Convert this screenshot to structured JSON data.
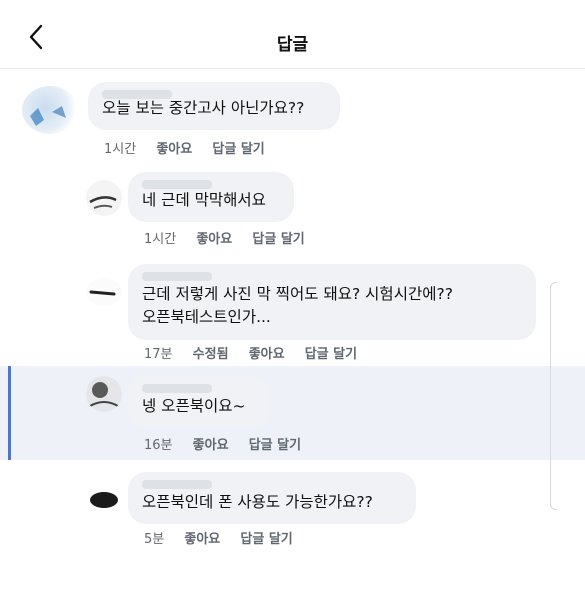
{
  "header": {
    "title": "답글",
    "back_icon": "chevron-left-icon"
  },
  "comments": [
    {
      "text": "오늘 보는 중간고사 아닌가요??",
      "time": "1시간",
      "edited": "",
      "like": "좋아요",
      "reply": "답글 달기"
    },
    {
      "text": "네 근데 막막해서요",
      "time": "1시간",
      "edited": "",
      "like": "좋아요",
      "reply": "답글 달기"
    },
    {
      "text": "근데 저렇게 사진 막 찍어도 돼요? 시험시간에??\n오픈북테스트인가...",
      "time": "17분",
      "edited": "수정됨",
      "like": "좋아요",
      "reply": "답글 달기"
    },
    {
      "text": "넹 오픈북이요~",
      "time": "16분",
      "edited": "",
      "like": "좋아요",
      "reply": "답글 달기"
    },
    {
      "text": "오픈북인데 폰 사용도 가능한가요??",
      "time": "5분",
      "edited": "",
      "like": "좋아요",
      "reply": "답글 달기"
    }
  ],
  "colors": {
    "bubble": "#f0f2f5",
    "highlight": "#eef2f8",
    "highlight_bar": "#4a76c9"
  }
}
